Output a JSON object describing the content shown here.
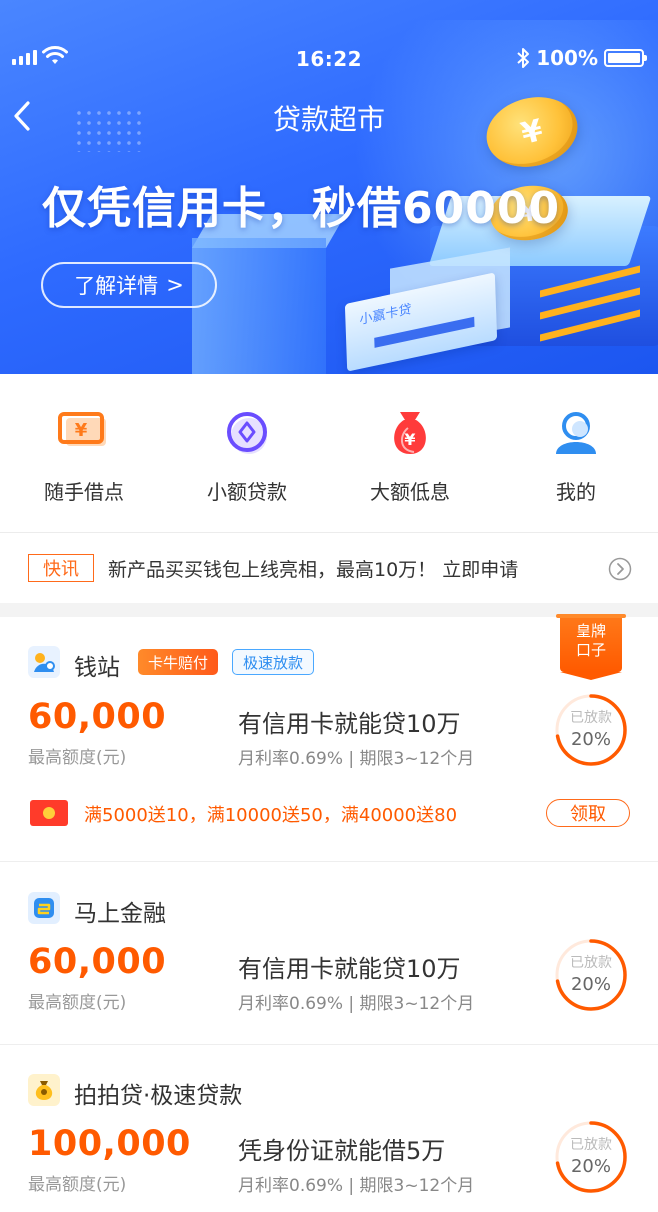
{
  "status_bar": {
    "time": "16:22",
    "battery": "100%"
  },
  "nav": {
    "title": "贷款超市"
  },
  "banner": {
    "headline": "仅凭信用卡，秒借60000",
    "button_label": "了解详情",
    "button_arrow": ">",
    "card_label": "小赢卡贷",
    "coin_symbol": "¥"
  },
  "quick_menu": [
    {
      "label": "随手借点",
      "icon": "bill-icon",
      "color": "#ff7a1a"
    },
    {
      "label": "小额贷款",
      "icon": "coin-circle-icon",
      "color": "#6a4dff"
    },
    {
      "label": "大额低息",
      "icon": "money-bag-icon",
      "color": "#ff3b3b"
    },
    {
      "label": "我的",
      "icon": "user-icon",
      "color": "#2f8ef0"
    }
  ],
  "news": {
    "tag": "快讯",
    "text": "新产品买买钱包上线亮相，最高10万！  立即申请"
  },
  "badge": {
    "line1": "皇牌",
    "line2": "口子"
  },
  "loans": [
    {
      "name": "钱站",
      "tags": [
        "卡牛赔付",
        "极速放款"
      ],
      "amount": "60,000",
      "amount_label": "最高额度(元)",
      "headline": "有信用卡就能贷10万",
      "terms": "月利率0.69% |  期限3~12个月",
      "progress_label": "已放款",
      "progress_text": "20%",
      "progress": 0.2,
      "promo_text": "满5000送10，满10000送50，满40000送80",
      "promo_button": "领取"
    },
    {
      "name": "马上金融",
      "amount": "60,000",
      "amount_label": "最高额度(元)",
      "headline": "有信用卡就能贷10万",
      "terms": "月利率0.69% |  期限3~12个月",
      "progress_label": "已放款",
      "progress_text": "20%",
      "progress": 0.2
    },
    {
      "name": "拍拍贷·极速贷款",
      "amount": "100,000",
      "amount_label": "最高额度(元)",
      "headline": "凭身份证就能借5万",
      "terms": "月利率0.69% |  期限3~12个月",
      "progress_label": "已放款",
      "progress_text": "20%",
      "progress": 0.2
    }
  ],
  "colors": {
    "brand_blue": "#2f6bff",
    "accent_orange": "#ff5a00"
  }
}
